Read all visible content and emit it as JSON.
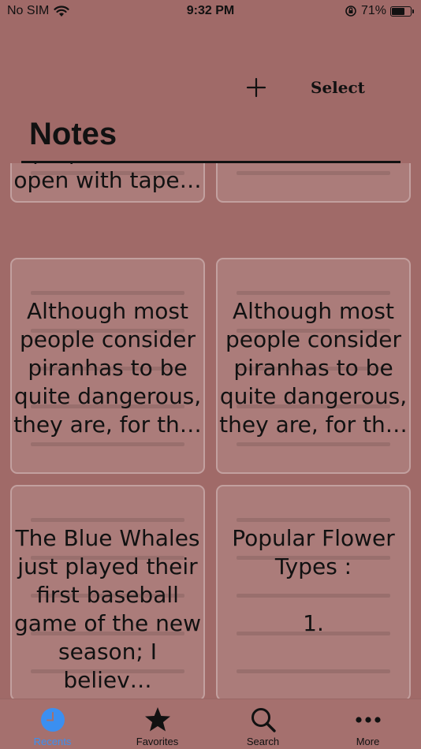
{
  "status_bar": {
    "carrier": "No SIM",
    "time": "9:32 PM",
    "battery_percent": "71%",
    "battery_level": 0.71
  },
  "nav": {
    "add_label": "+",
    "select_label": "Select",
    "title": "Notes"
  },
  "notes": [
    {
      "text": "prop the door\nopen with tape…"
    },
    {
      "text": ""
    },
    {
      "text": "Although most\npeople consider\npiranhas to be\nquite dangerous,\nthey are, for th…"
    },
    {
      "text": "Although most\npeople consider\npiranhas to be\nquite dangerous,\nthey are, for th…"
    },
    {
      "text": "The Blue Whales\njust played their\nfirst baseball\ngame of the new\nseason; I believ…"
    },
    {
      "text": "Popular Flower\nTypes :\n\n1."
    }
  ],
  "tabs": [
    {
      "label": "Recents",
      "icon": "clock-icon",
      "active": true
    },
    {
      "label": "Favorites",
      "icon": "star-icon",
      "active": false
    },
    {
      "label": "Search",
      "icon": "search-icon",
      "active": false
    },
    {
      "label": "More",
      "icon": "more-icon",
      "active": false
    }
  ],
  "colors": {
    "background": "#a06a68",
    "accent": "#3b8ff0",
    "text": "#111111"
  }
}
